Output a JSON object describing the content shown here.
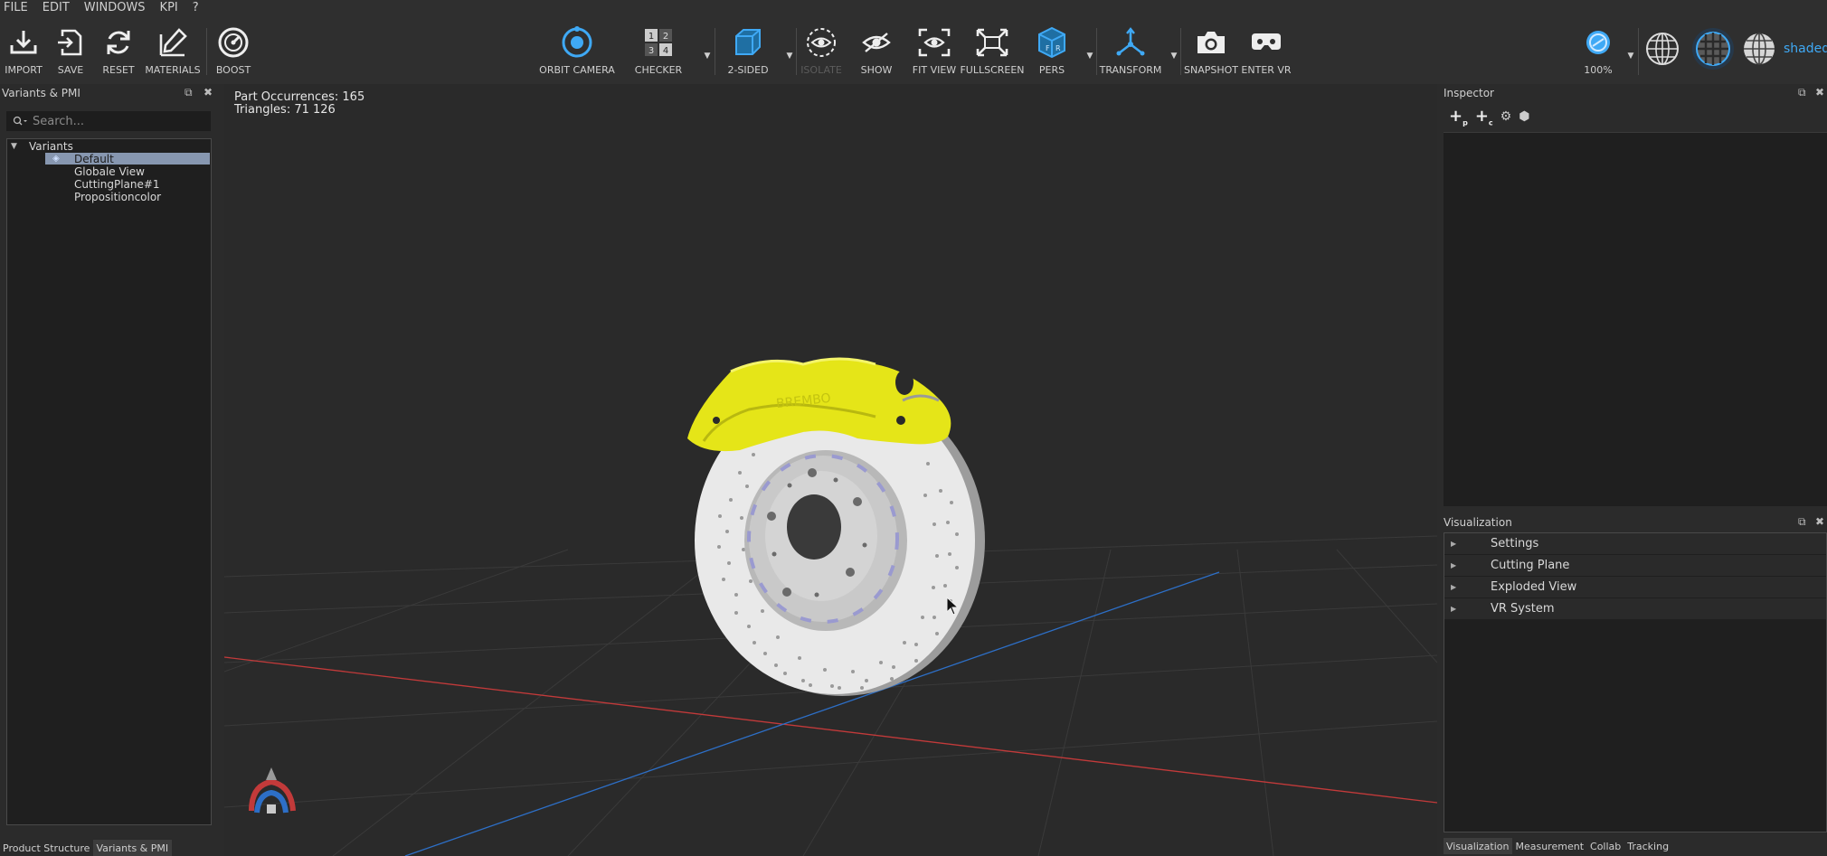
{
  "menu": [
    "FILE",
    "EDIT",
    "WINDOWS",
    "KPI",
    "?"
  ],
  "toolbar": {
    "import": "IMPORT",
    "save": "SAVE",
    "reset": "RESET",
    "materials": "MATERIALS",
    "boost": "BOOST",
    "orbit": "ORBIT CAMERA",
    "checker": "CHECKER",
    "two_sided": "2-SIDED",
    "isolate": "ISOLATE",
    "show": "SHOW",
    "fit_view": "FIT VIEW",
    "fullscreen": "FULLSCREEN",
    "pers": "PERS",
    "transform": "TRANSFORM",
    "snapshot": "SNAPSHOT",
    "enter_vr": "ENTER VR",
    "zoom": "100%",
    "render_mode": "shaded",
    "accent": "#3fa9f5"
  },
  "left_panel": {
    "title": "Variants & PMI",
    "search_placeholder": "Search...",
    "tree": {
      "root": "Variants",
      "items": [
        "Default",
        "Globale View",
        "CuttingPlane#1",
        "Propositioncolor"
      ],
      "selected": "Default"
    },
    "tabs": [
      "Product Structure",
      "Variants & PMI"
    ],
    "active_tab": "Variants & PMI"
  },
  "viewport": {
    "part_occurrences": "Part Occurrences: 165",
    "triangles": "Triangles: 71 126"
  },
  "inspector": {
    "title": "Inspector"
  },
  "visualization": {
    "title": "Visualization",
    "items": [
      "Settings",
      "Cutting Plane",
      "Exploded View",
      "VR System"
    ],
    "tabs": [
      "Visualization",
      "Measurement",
      "Collab",
      "Tracking"
    ],
    "active_tab": "Visualization"
  },
  "icons": [
    "import-icon",
    "save-icon",
    "reset-icon",
    "materials-icon",
    "boost-icon",
    "orbit-camera-icon",
    "checker-icon",
    "two-sided-icon",
    "isolate-icon",
    "show-icon",
    "fit-view-icon",
    "fullscreen-icon",
    "pers-icon",
    "transform-icon",
    "snapshot-icon",
    "enter-vr-icon"
  ]
}
